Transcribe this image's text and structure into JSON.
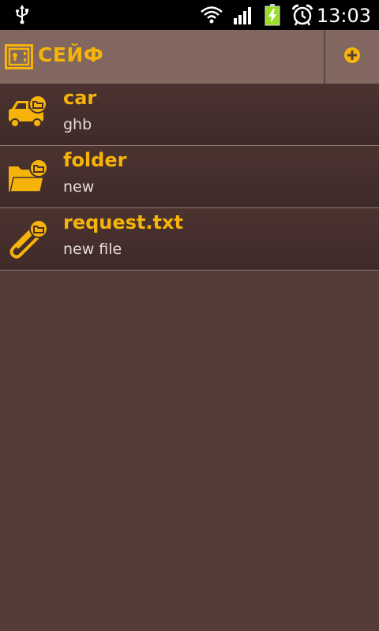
{
  "status_bar": {
    "time": "13:03",
    "icons": [
      "usb-icon",
      "wifi-icon",
      "signal-icon",
      "battery-charging-icon",
      "alarm-icon"
    ]
  },
  "action_bar": {
    "title": "СЕЙФ",
    "icon": "safe-icon",
    "add_icon": "add-circle-icon",
    "accent_color": "#f6b40a"
  },
  "items": [
    {
      "name": "car",
      "description": "ghb",
      "icon": "car-icon"
    },
    {
      "name": "folder",
      "description": "new",
      "icon": "folder-icon"
    },
    {
      "name": "request.txt",
      "description": "new file",
      "icon": "paperclip-icon"
    }
  ],
  "colors": {
    "background": "#563c39",
    "action_bar": "#816760",
    "list_item": "#46302d",
    "accent": "#f6b40a",
    "text_secondary": "#e4dbd8"
  }
}
